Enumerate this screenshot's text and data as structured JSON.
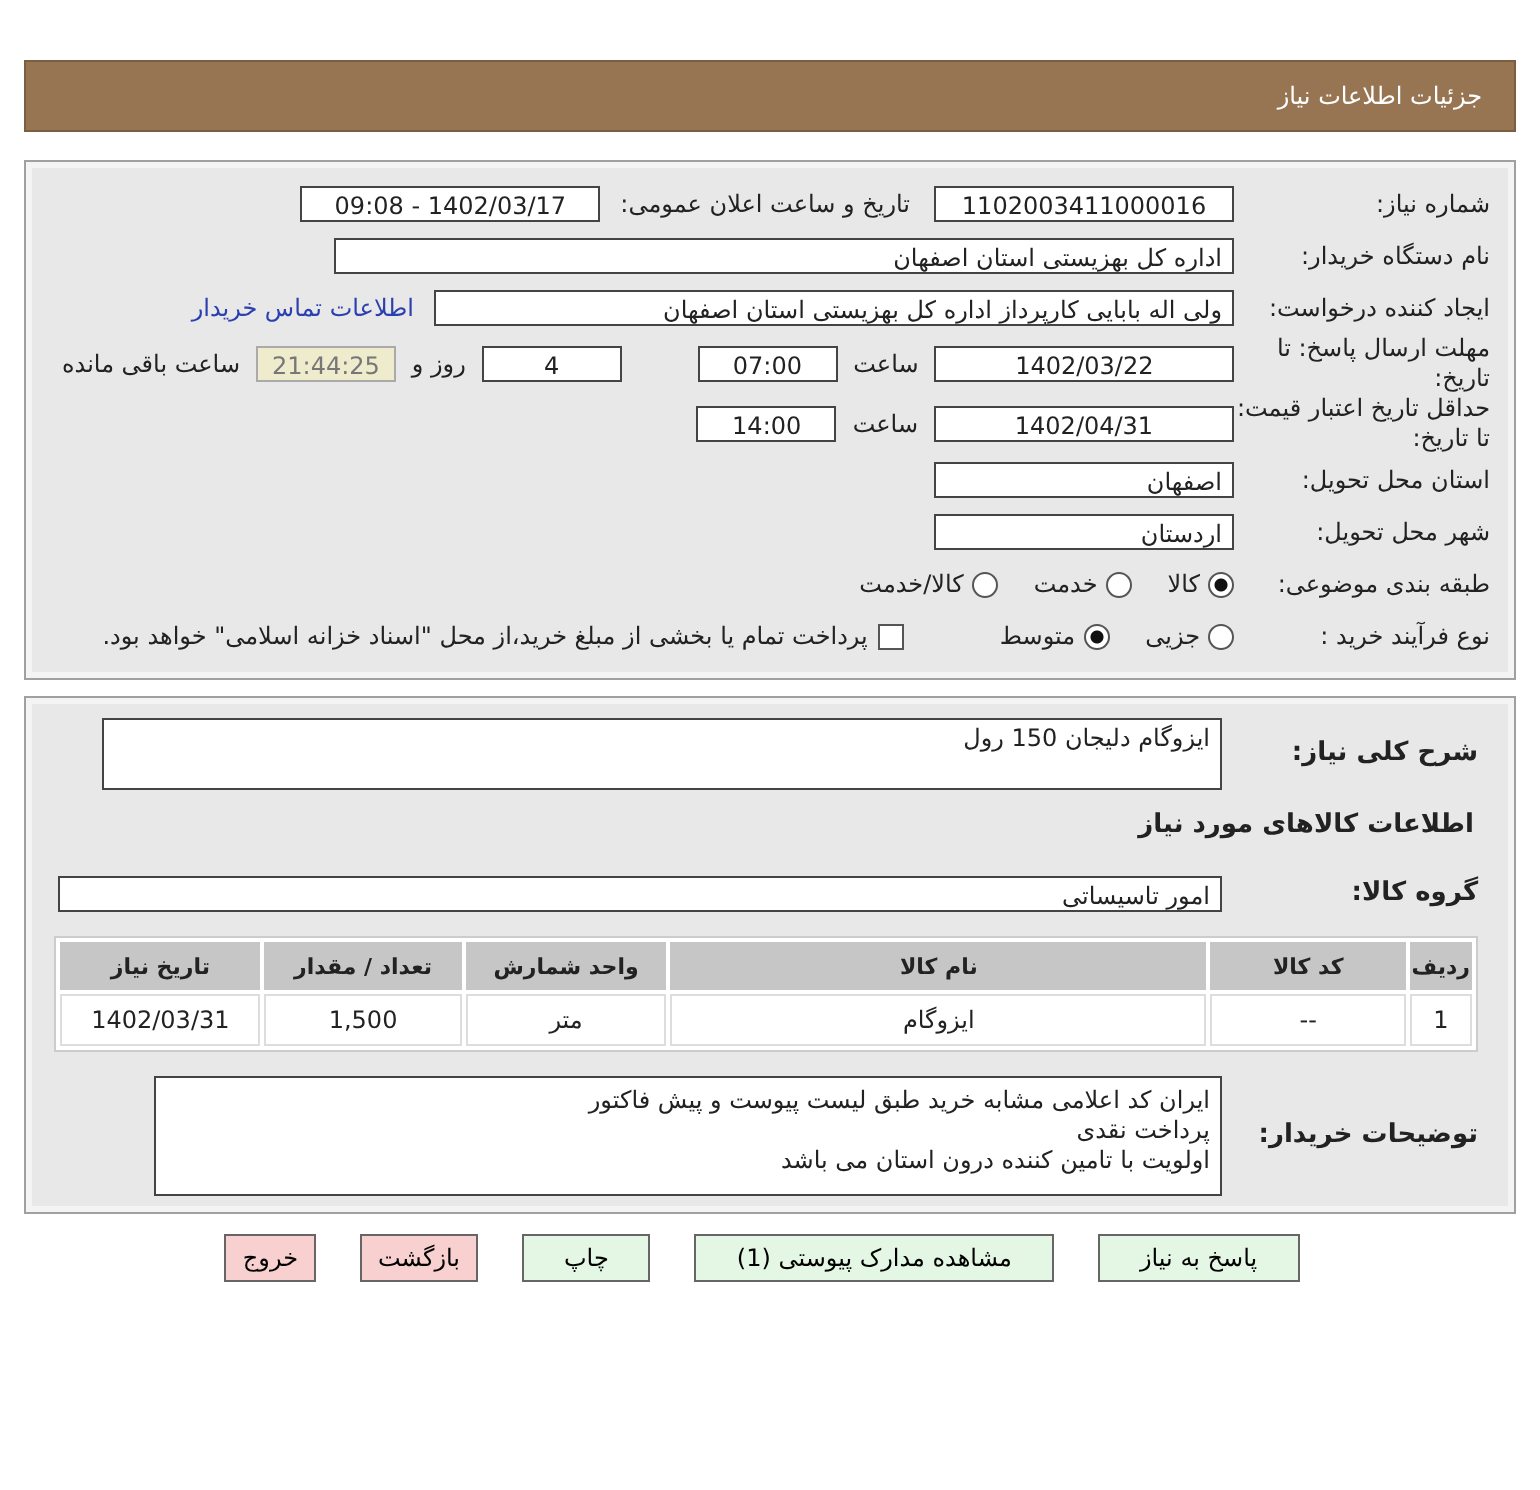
{
  "header": {
    "title": "جزئیات اطلاعات نیاز"
  },
  "need_number": {
    "label": "شماره نیاز:",
    "value": "1102003411000016"
  },
  "announce": {
    "label": "تاریخ و ساعت اعلان عمومی:",
    "value": "1402/03/17 - 09:08"
  },
  "buyer_org": {
    "label": "نام دستگاه خریدار:",
    "value": "اداره کل بهزیستی استان اصفهان"
  },
  "requester": {
    "label": "ایجاد کننده درخواست:",
    "value": "ولی اله بابایی کارپرداز اداره کل بهزیستی استان اصفهان",
    "link": "اطلاعات تماس خریدار"
  },
  "deadline": {
    "label": "مهلت ارسال پاسخ: تا تاریخ:",
    "date": "1402/03/22",
    "time_label": "ساعت",
    "time": "07:00",
    "days": "4",
    "days_label": "روز و",
    "remaining": "21:44:25",
    "remaining_label": "ساعت باقی مانده"
  },
  "validity": {
    "label": "حداقل تاریخ اعتبار قیمت: تا تاریخ:",
    "date": "1402/04/31",
    "time_label": "ساعت",
    "time": "14:00"
  },
  "province": {
    "label": "استان محل تحویل:",
    "value": "اصفهان"
  },
  "city": {
    "label": "شهر محل تحویل:",
    "value": "اردستان"
  },
  "category": {
    "label": "طبقه بندی موضوعی:",
    "options": [
      {
        "label": "کالا",
        "selected": true
      },
      {
        "label": "خدمت",
        "selected": false
      },
      {
        "label": "کالا/خدمت",
        "selected": false
      }
    ]
  },
  "process": {
    "label": "نوع فرآیند خرید :",
    "options": [
      {
        "label": "جزیی",
        "selected": false
      },
      {
        "label": "متوسط",
        "selected": true
      }
    ],
    "checkbox": {
      "label": "پرداخت تمام یا بخشی از مبلغ خرید،از محل \"اسناد خزانه اسلامی\" خواهد بود.",
      "checked": false
    }
  },
  "description": {
    "label": "شرح کلی نیاز:",
    "value": "ایزوگام دلیجان 150 رول"
  },
  "goods_heading": "اطلاعات کالاهای مورد نیاز",
  "goods_group": {
    "label": "گروه کالا:",
    "value": "امور تاسیساتی"
  },
  "table": {
    "columns": [
      "ردیف",
      "کد کالا",
      "نام کالا",
      "واحد شمارش",
      "تعداد / مقدار",
      "تاریخ نیاز"
    ],
    "rows": [
      [
        "1",
        "--",
        "ایزوگام",
        "متر",
        "1,500",
        "1402/03/31"
      ]
    ]
  },
  "notes": {
    "label": "توضیحات خریدار:",
    "lines": [
      "ایران کد اعلامی مشابه خرید طبق لیست پیوست و پیش فاکتور",
      "پرداخت نقدی",
      "اولویت با تامین کننده درون استان می باشد"
    ]
  },
  "buttons": [
    {
      "label": "پاسخ به نیاز",
      "kind": "action"
    },
    {
      "label": "مشاهده مدارک پیوستی (1)",
      "kind": "action"
    },
    {
      "label": "چاپ",
      "kind": "action"
    },
    {
      "label": "بازگشت",
      "kind": "exit"
    },
    {
      "label": "خروج",
      "kind": "exit"
    }
  ]
}
